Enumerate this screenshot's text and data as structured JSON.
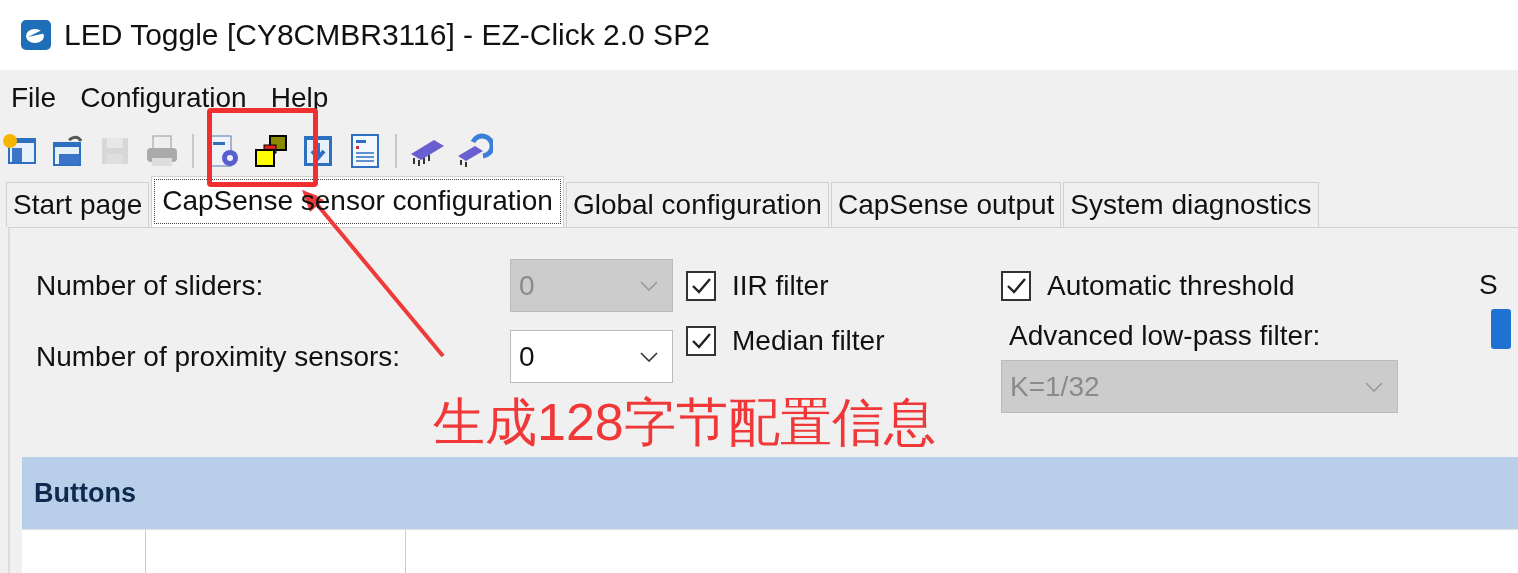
{
  "window": {
    "title": "LED Toggle [CY8CMBR3116] - EZ-Click 2.0 SP2"
  },
  "menu": [
    "File",
    "Configuration",
    "Help"
  ],
  "toolbar": [
    {
      "kind": "button",
      "disabled": false
    },
    {
      "kind": "button",
      "disabled": false
    },
    {
      "kind": "button",
      "disabled": true
    },
    {
      "kind": "button",
      "disabled": false
    },
    {
      "kind": "separator"
    },
    {
      "kind": "button",
      "disabled": false
    },
    {
      "kind": "button",
      "disabled": false
    },
    {
      "kind": "button",
      "disabled": false
    },
    {
      "kind": "button",
      "disabled": false
    },
    {
      "kind": "separator"
    },
    {
      "kind": "button",
      "disabled": false
    },
    {
      "kind": "button",
      "disabled": false
    }
  ],
  "tabs": [
    {
      "label": "Start page",
      "selected": false
    },
    {
      "label": "CapSense sensor configuration",
      "selected": true
    },
    {
      "label": "Global configuration",
      "selected": false
    },
    {
      "label": "CapSense output",
      "selected": false
    },
    {
      "label": "System diagnostics",
      "selected": false
    }
  ],
  "fields": [
    {
      "label": "Number of sliders:",
      "value": "0",
      "disabled": true
    },
    {
      "label": "Number of proximity sensors:",
      "value": "0",
      "disabled": false
    }
  ],
  "filters": [
    {
      "label": "IIR filter",
      "checked": true
    },
    {
      "label": "Median filter",
      "checked": true
    }
  ],
  "threshold": {
    "label": "Automatic threshold",
    "checked": true
  },
  "low_pass": {
    "label": "Advanced low-pass filter:",
    "value": "K=1/32",
    "disabled": true
  },
  "column_4": {
    "label": "S"
  },
  "section": {
    "title": "Buttons"
  },
  "annotation": {
    "text": "生成128字节配置信息"
  }
}
